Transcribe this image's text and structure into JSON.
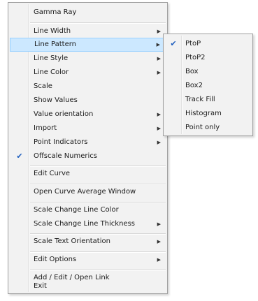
{
  "context_menu": {
    "items": [
      {
        "label": "Gamma Ray",
        "submenu": false,
        "checked": false
      },
      {
        "label": "Line Width",
        "submenu": true,
        "checked": false
      },
      {
        "label": "Line Pattern",
        "submenu": true,
        "checked": false,
        "highlighted": true
      },
      {
        "label": "Line Style",
        "submenu": true,
        "checked": false
      },
      {
        "label": "Line Color",
        "submenu": true,
        "checked": false
      },
      {
        "label": "Scale",
        "submenu": false,
        "checked": false
      },
      {
        "label": "Show Values",
        "submenu": false,
        "checked": false
      },
      {
        "label": "Value orientation",
        "submenu": true,
        "checked": false
      },
      {
        "label": "Import",
        "submenu": true,
        "checked": false
      },
      {
        "label": "Point Indicators",
        "submenu": true,
        "checked": false
      },
      {
        "label": "Offscale Numerics",
        "submenu": false,
        "checked": true
      },
      {
        "label": "Edit Curve",
        "submenu": false,
        "checked": false
      },
      {
        "label": "Open Curve Average Window",
        "submenu": false,
        "checked": false
      },
      {
        "label": "Scale Change Line Color",
        "submenu": false,
        "checked": false
      },
      {
        "label": "Scale Change Line Thickness",
        "submenu": true,
        "checked": false
      },
      {
        "label": "Scale Text Orientation",
        "submenu": true,
        "checked": false
      },
      {
        "label": "Edit Options",
        "submenu": true,
        "checked": false
      },
      {
        "label": "Add / Edit / Open Link",
        "submenu": false,
        "checked": false
      },
      {
        "label": "Exit",
        "submenu": false,
        "checked": false
      }
    ],
    "check_glyph": "✔",
    "arrow_glyph": "▶"
  },
  "line_pattern_submenu": {
    "items": [
      {
        "label": "PtoP",
        "checked": true
      },
      {
        "label": "PtoP2",
        "checked": false
      },
      {
        "label": "Box",
        "checked": false
      },
      {
        "label": "Box2",
        "checked": false
      },
      {
        "label": "Track Fill",
        "checked": false
      },
      {
        "label": "Histogram",
        "checked": false
      },
      {
        "label": "Point only",
        "checked": false
      }
    ]
  },
  "colors": {
    "menu_bg": "#f2f2f2",
    "highlight_bg": "#cce8ff",
    "highlight_border": "#99d1ff",
    "check_color": "#1f5fbf"
  }
}
